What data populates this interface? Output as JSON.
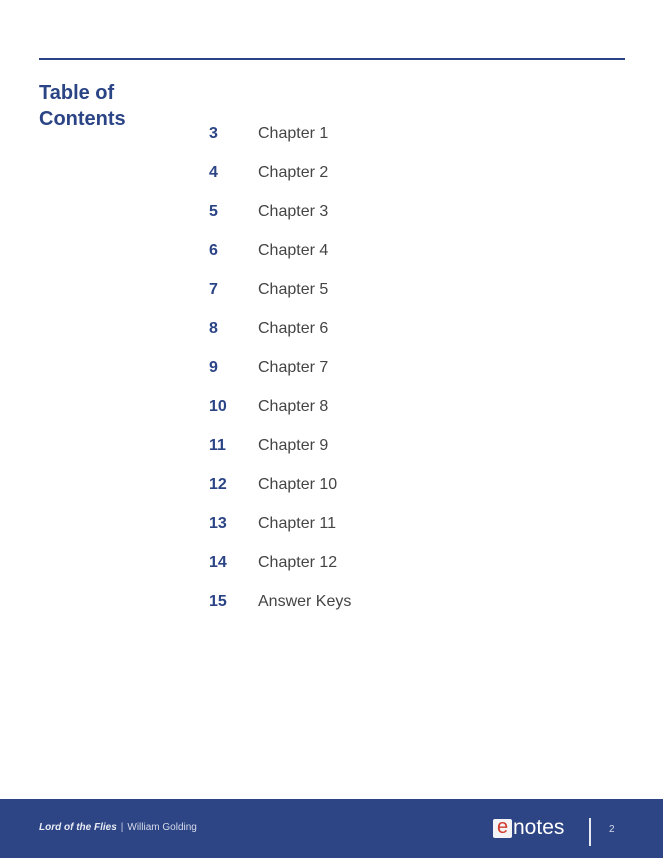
{
  "header": {
    "title": "Table of Contents"
  },
  "toc": {
    "entries": [
      {
        "page": "3",
        "label": "Chapter 1"
      },
      {
        "page": "4",
        "label": "Chapter 2"
      },
      {
        "page": "5",
        "label": "Chapter 3"
      },
      {
        "page": "6",
        "label": "Chapter 4"
      },
      {
        "page": "7",
        "label": "Chapter 5"
      },
      {
        "page": "8",
        "label": "Chapter 6"
      },
      {
        "page": "9",
        "label": "Chapter 7"
      },
      {
        "page": "10",
        "label": "Chapter 8"
      },
      {
        "page": "11",
        "label": "Chapter 9"
      },
      {
        "page": "12",
        "label": "Chapter 10"
      },
      {
        "page": "13",
        "label": "Chapter 11"
      },
      {
        "page": "14",
        "label": "Chapter 12"
      },
      {
        "page": "15",
        "label": "Answer Keys"
      }
    ]
  },
  "footer": {
    "book_title": "Lord of the Flies",
    "separator": "|",
    "author": "William Golding",
    "logo_e": "e",
    "logo_text": "notes",
    "page_number": "2"
  },
  "colors": {
    "brand_blue": "#2b4486",
    "footer_bg": "#2d4585",
    "logo_red": "#d33a2c"
  }
}
